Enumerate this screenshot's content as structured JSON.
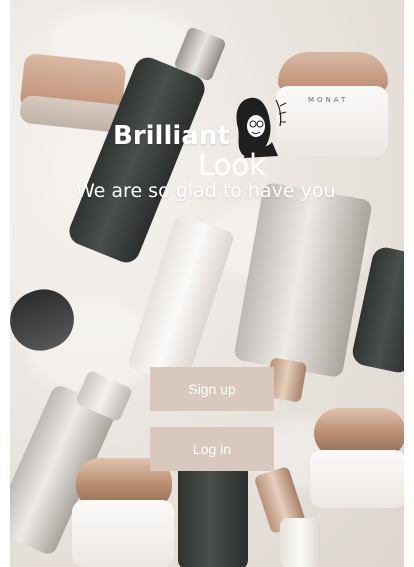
{
  "app": {
    "title_line1": "Brilliant",
    "title_line2": "Look",
    "tagline": "We are so glad to have you"
  },
  "actions": {
    "signup_label": "Sign up",
    "login_label": "Log in"
  },
  "colors": {
    "button_bg": "#d9c8bd",
    "text": "#ffffff"
  },
  "icons": {
    "logo": "woman-portrait-illustration"
  },
  "background": {
    "brand_text": "MONAT"
  }
}
